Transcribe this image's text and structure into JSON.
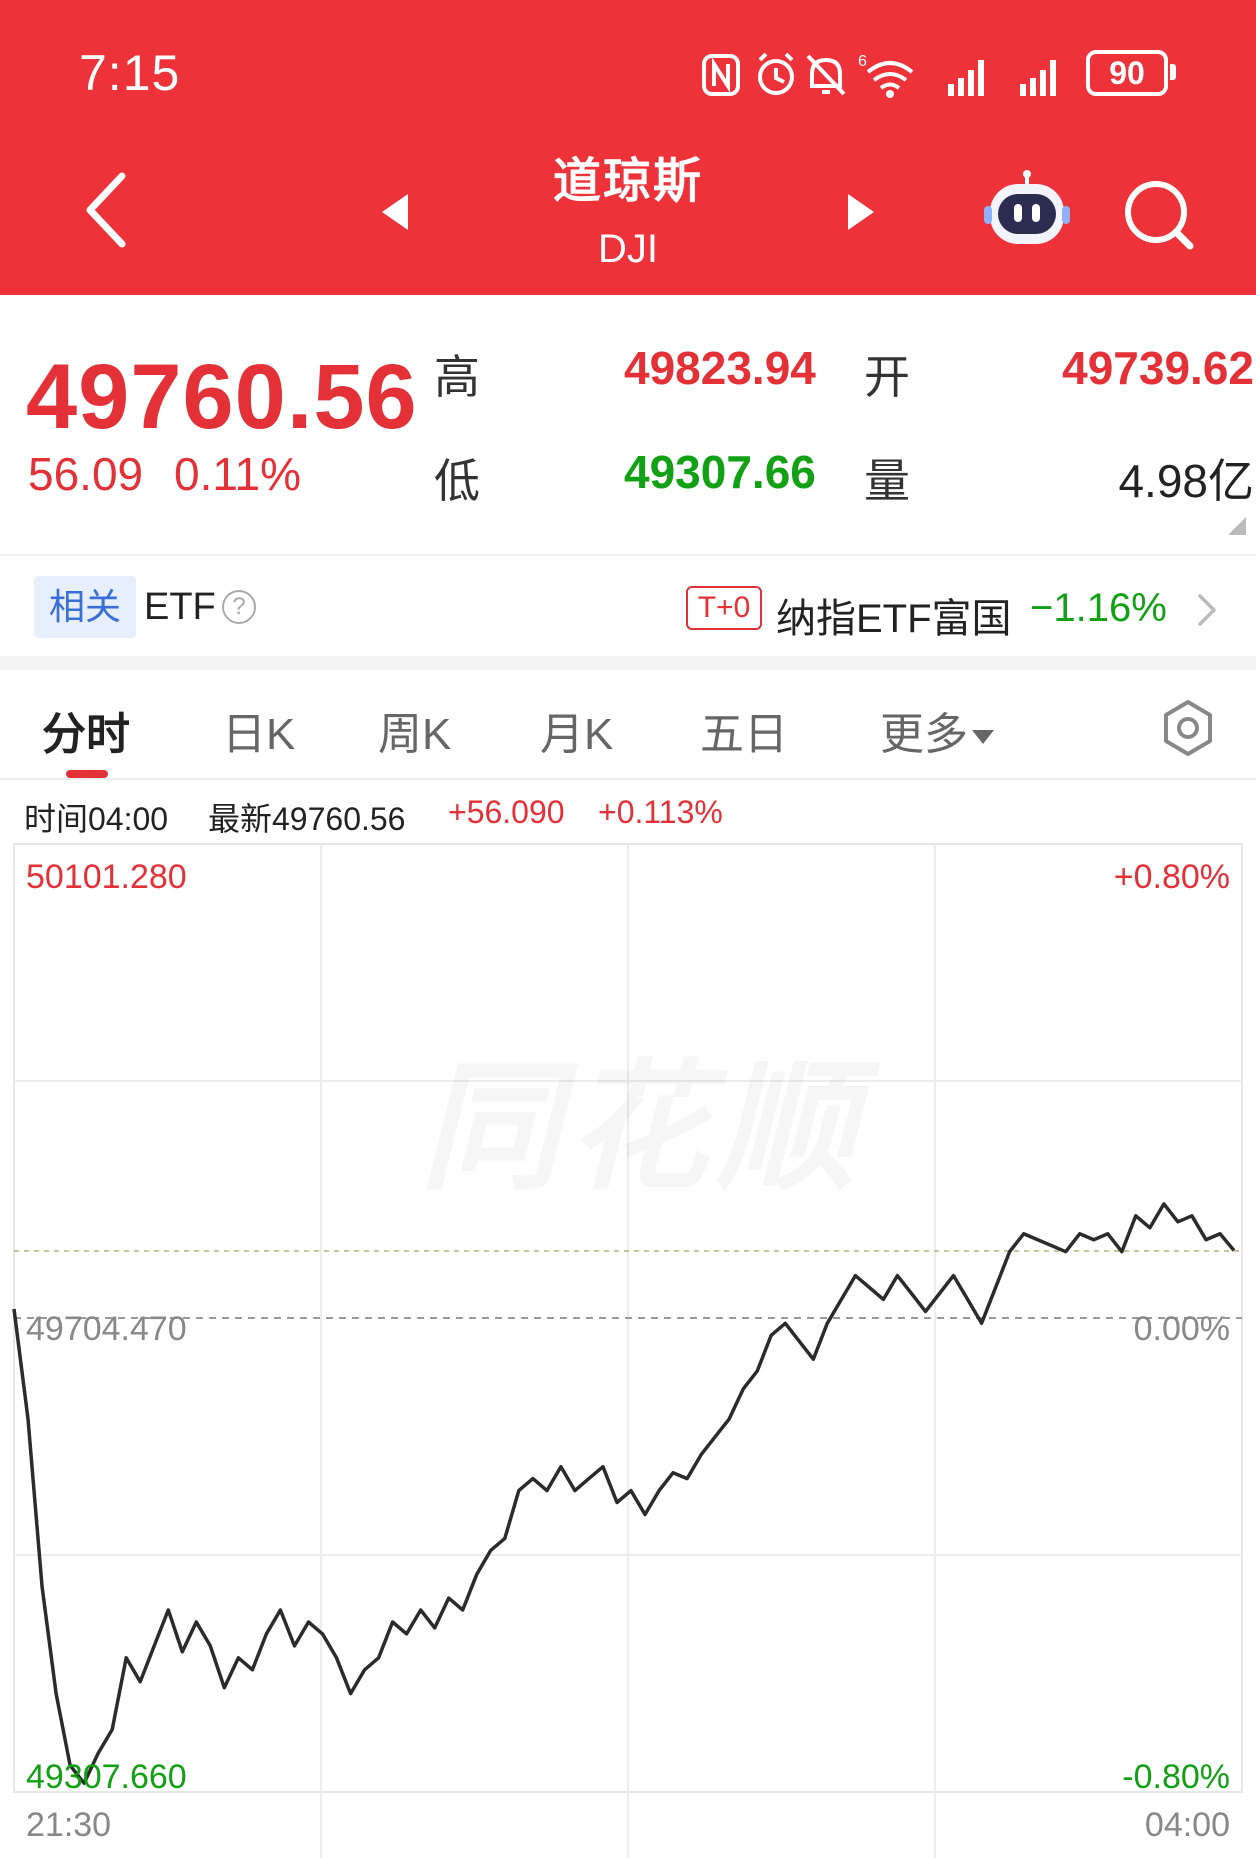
{
  "status_bar": {
    "time": "7:15",
    "battery": "90",
    "wifi_badge": "6"
  },
  "header": {
    "title": "道琼斯",
    "code": "DJI"
  },
  "quote": {
    "price": "49760.56",
    "change": "56.09",
    "change_pct": "0.11%",
    "high_label": "高",
    "high": "49823.94",
    "open_label": "开",
    "open": "49739.62",
    "low_label": "低",
    "low": "49307.66",
    "volume_label": "量",
    "volume": "4.98亿"
  },
  "etf": {
    "tag": "相关",
    "label": "ETF",
    "help": "?",
    "badge": "T+0",
    "name": "纳指ETF富国",
    "pct": "−1.16%"
  },
  "tabs": [
    {
      "label": "分时",
      "active": true
    },
    {
      "label": "日K"
    },
    {
      "label": "周K"
    },
    {
      "label": "月K"
    },
    {
      "label": "五日"
    },
    {
      "label": "更多"
    }
  ],
  "info": {
    "time": "时间04:00",
    "latest": "最新49760.56",
    "change": "+56.090",
    "change_pct": "+0.113%"
  },
  "chart_data": {
    "type": "line",
    "upper_price_label": "50101.280",
    "base_price_label": "49704.470",
    "lower_price_label": "49307.660",
    "upper_pct_label": "+0.80%",
    "base_pct_label": "0.00%",
    "lower_pct_label": "-0.80%",
    "start_time_label": "21:30",
    "end_time_label": "04:00",
    "watermark": "同花顺",
    "ylim": [
      49307.66,
      50101.28
    ],
    "base": 49704.47,
    "latest": 49760.56,
    "grid": true,
    "series": [
      {
        "values": [
          49712,
          49620,
          49480,
          49390,
          49330,
          49315,
          49340,
          49360,
          49420,
          49400,
          49430,
          49460,
          49425,
          49450,
          49430,
          49395,
          49420,
          49410,
          49440,
          49460,
          49430,
          49450,
          49440,
          49420,
          49390,
          49410,
          49420,
          49450,
          49440,
          49460,
          49445,
          49470,
          49460,
          49490,
          49510,
          49520,
          49560,
          49570,
          49560,
          49580,
          49560,
          49570,
          49580,
          49550,
          49560,
          49540,
          49560,
          49575,
          49570,
          49590,
          49605,
          49620,
          49645,
          49660,
          49690,
          49700,
          49685,
          49670,
          49700,
          49720,
          49740,
          49730,
          49720,
          49740,
          49725,
          49710,
          49725,
          49740,
          49720,
          49700,
          49730,
          49760,
          49775,
          49770,
          49765,
          49760,
          49775,
          49770,
          49775,
          49760,
          49790,
          49780,
          49800,
          49785,
          49790,
          49770,
          49775,
          49761
        ]
      }
    ]
  },
  "colors": {
    "header_bg": "#ee3239",
    "up": "#e43137",
    "down": "#12a014",
    "line": "#2b2b2b",
    "etf_tag_text": "#3a6fd8"
  }
}
